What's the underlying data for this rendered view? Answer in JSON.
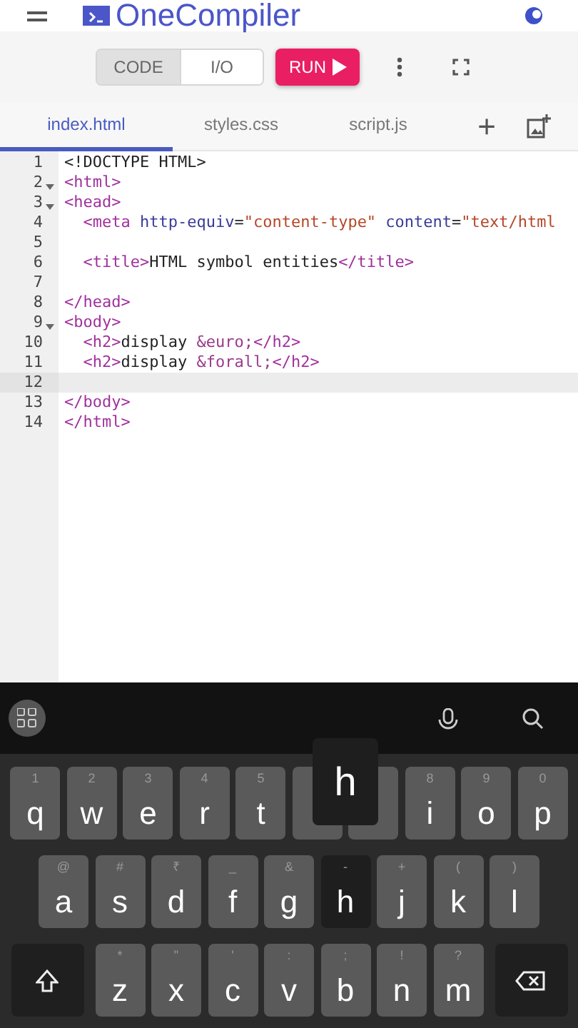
{
  "app_bar": {
    "title": "OneCompiler"
  },
  "toolbar": {
    "modes": [
      {
        "label": "CODE",
        "selected": true
      },
      {
        "label": "I/O",
        "selected": false
      }
    ],
    "run_button": "RUN"
  },
  "tabs": [
    {
      "label": "index.html",
      "selected": true
    },
    {
      "label": "styles.css",
      "selected": false
    },
    {
      "label": "script.js",
      "selected": false
    }
  ],
  "add_tab": "+",
  "editor": {
    "lines": [
      {
        "number": "1",
        "foldable": false,
        "active": false,
        "segments": [
          {
            "kind": "plain",
            "text": "<!DOCTYPE HTML>"
          }
        ]
      },
      {
        "number": "2",
        "foldable": true,
        "active": false,
        "segments": [
          {
            "kind": "tag",
            "text": "<html>"
          }
        ]
      },
      {
        "number": "3",
        "foldable": true,
        "active": false,
        "segments": [
          {
            "kind": "tag",
            "text": "<head>"
          }
        ]
      },
      {
        "number": "4",
        "foldable": false,
        "active": false,
        "segments": [
          {
            "kind": "tag",
            "text": "  <meta"
          },
          {
            "kind": "attr",
            "text": " http-equiv"
          },
          {
            "kind": "plain",
            "text": "="
          },
          {
            "kind": "string",
            "text": "\"content-type\""
          },
          {
            "kind": "attr",
            "text": " content"
          },
          {
            "kind": "plain",
            "text": "="
          },
          {
            "kind": "string",
            "text": "\"text/html"
          }
        ]
      },
      {
        "number": "5",
        "foldable": false,
        "active": false
      },
      {
        "number": "6",
        "foldable": false,
        "active": false,
        "segments": [
          {
            "kind": "tag",
            "text": "  <title>"
          },
          {
            "kind": "plain",
            "text": "HTML symbol entities"
          },
          {
            "kind": "tag",
            "text": "</title>"
          }
        ]
      },
      {
        "number": "7",
        "foldable": false,
        "active": false
      },
      {
        "number": "8",
        "foldable": false,
        "active": false,
        "segments": [
          {
            "kind": "tag",
            "text": "</head>"
          }
        ]
      },
      {
        "number": "9",
        "foldable": true,
        "active": false,
        "segments": [
          {
            "kind": "tag",
            "text": "<body>"
          }
        ]
      },
      {
        "number": "10",
        "foldable": false,
        "active": false,
        "segments": [
          {
            "kind": "tag",
            "text": "  <h2>"
          },
          {
            "kind": "plain",
            "text": "display "
          },
          {
            "kind": "entity",
            "text": "&euro;"
          },
          {
            "kind": "tag",
            "text": "</h2>"
          }
        ]
      },
      {
        "number": "11",
        "foldable": false,
        "active": false,
        "segments": [
          {
            "kind": "tag",
            "text": "  <h2>"
          },
          {
            "kind": "plain",
            "text": "display "
          },
          {
            "kind": "entity",
            "text": "&forall;"
          },
          {
            "kind": "tag",
            "text": "</h2>"
          }
        ]
      },
      {
        "number": "12",
        "foldable": false,
        "active": true
      },
      {
        "number": "13",
        "foldable": false,
        "active": false,
        "segments": [
          {
            "kind": "tag",
            "text": "</body>"
          }
        ]
      },
      {
        "number": "14",
        "foldable": false,
        "active": false,
        "segments": [
          {
            "kind": "tag",
            "text": "</html>"
          }
        ]
      }
    ]
  },
  "keyboard": {
    "popup": "h",
    "rows": [
      [
        {
          "kind": "letter",
          "label": "q",
          "hint": "1",
          "pressed": false
        },
        {
          "kind": "letter",
          "label": "w",
          "hint": "2",
          "pressed": false
        },
        {
          "kind": "letter",
          "label": "e",
          "hint": "3",
          "pressed": false
        },
        {
          "kind": "letter",
          "label": "r",
          "hint": "4",
          "pressed": false
        },
        {
          "kind": "letter",
          "label": "t",
          "hint": "5",
          "pressed": false
        },
        {
          "kind": "letter",
          "pressed": false
        },
        {
          "kind": "letter",
          "pressed": false
        },
        {
          "kind": "letter",
          "label": "i",
          "hint": "8",
          "pressed": false
        },
        {
          "kind": "letter",
          "label": "o",
          "hint": "9",
          "pressed": false
        },
        {
          "kind": "letter",
          "label": "p",
          "hint": "0",
          "pressed": false
        }
      ],
      [
        {
          "kind": "letter",
          "label": "a",
          "hint": "@",
          "pressed": false
        },
        {
          "kind": "letter",
          "label": "s",
          "hint": "#",
          "pressed": false
        },
        {
          "kind": "letter",
          "label": "d",
          "hint": "₹",
          "pressed": false
        },
        {
          "kind": "letter",
          "label": "f",
          "hint": "_",
          "pressed": false
        },
        {
          "kind": "letter",
          "label": "g",
          "hint": "&",
          "pressed": false
        },
        {
          "kind": "letter",
          "label": "h",
          "hint": "-",
          "pressed": true
        },
        {
          "kind": "letter",
          "label": "j",
          "hint": "+",
          "pressed": false
        },
        {
          "kind": "letter",
          "label": "k",
          "hint": "(",
          "pressed": false
        },
        {
          "kind": "letter",
          "label": "l",
          "hint": ")",
          "pressed": false
        }
      ],
      [
        {
          "kind": "shift",
          "pressed": false
        },
        {
          "kind": "letter",
          "label": "z",
          "hint": "*",
          "pressed": false
        },
        {
          "kind": "letter",
          "label": "x",
          "hint": "\"",
          "pressed": false
        },
        {
          "kind": "letter",
          "label": "c",
          "hint": "'",
          "pressed": false
        },
        {
          "kind": "letter",
          "label": "v",
          "hint": ":",
          "pressed": false
        },
        {
          "kind": "letter",
          "label": "b",
          "hint": ";",
          "pressed": false
        },
        {
          "kind": "letter",
          "label": "n",
          "hint": "!",
          "pressed": false
        },
        {
          "kind": "letter",
          "label": "m",
          "hint": "?",
          "pressed": false
        },
        {
          "kind": "backspace",
          "pressed": false
        }
      ]
    ]
  }
}
